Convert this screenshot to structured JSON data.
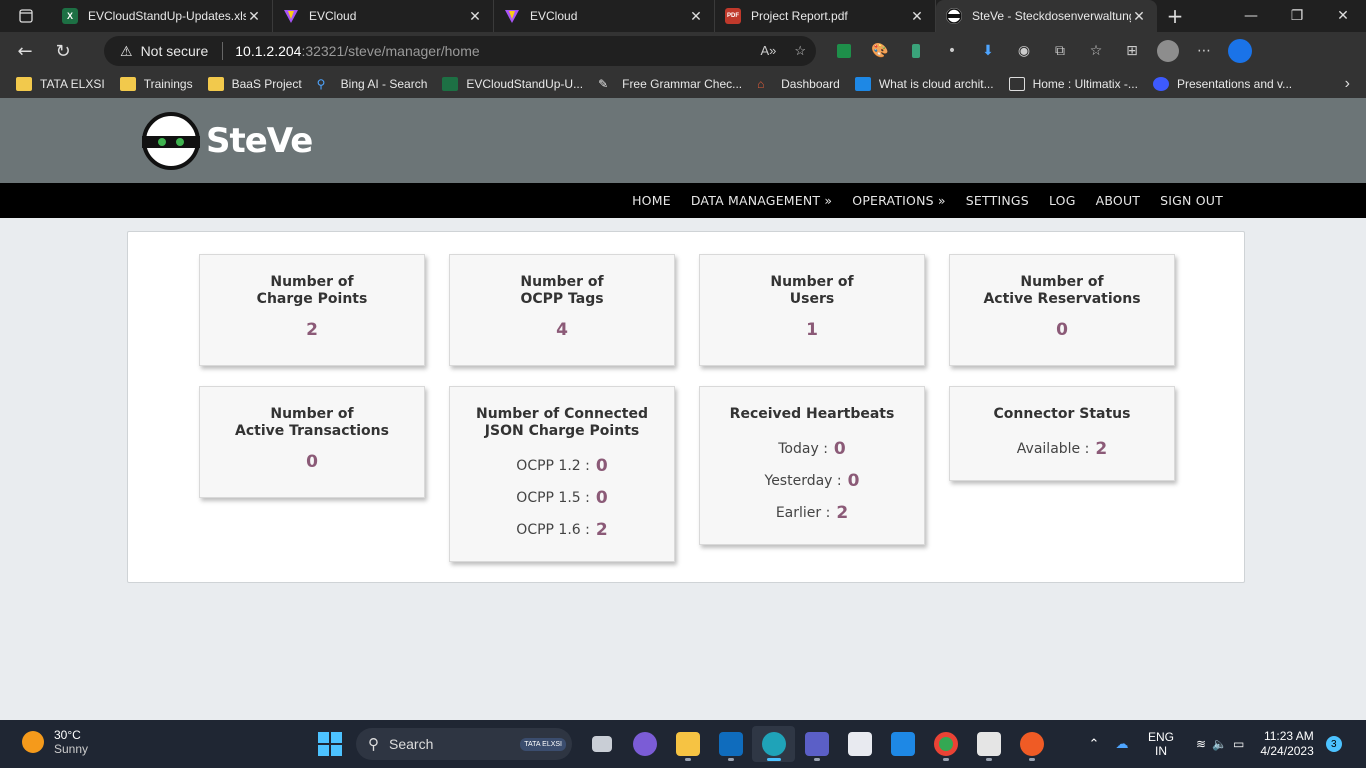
{
  "browser": {
    "tabs": [
      {
        "title": "EVCloudStandUp-Updates.xlsx",
        "icon": "excel-icon",
        "active": false
      },
      {
        "title": "EVCloud",
        "icon": "vite-icon",
        "active": false
      },
      {
        "title": "EVCloud",
        "icon": "vite-icon",
        "active": false
      },
      {
        "title": "Project Report.pdf",
        "icon": "pdf-icon",
        "active": false
      },
      {
        "title": "SteVe - Steckdosenverwaltung",
        "icon": "steve-icon",
        "active": true
      }
    ],
    "address": {
      "security_label": "Not secure",
      "host": "10.1.2.204",
      "path": ":32321/steve/manager/home"
    },
    "bookmarks": [
      {
        "label": "TATA ELXSI",
        "icon": "folder-icon"
      },
      {
        "label": "Trainings",
        "icon": "folder-icon"
      },
      {
        "label": "BaaS Project",
        "icon": "folder-icon"
      },
      {
        "label": "Bing AI - Search",
        "icon": "search-icon"
      },
      {
        "label": "EVCloudStandUp-U...",
        "icon": "excel-icon"
      },
      {
        "label": "Free Grammar Chec...",
        "icon": "pen-icon"
      },
      {
        "label": "Dashboard",
        "icon": "dashboard-icon"
      },
      {
        "label": "What is cloud archit...",
        "icon": "video-icon"
      },
      {
        "label": "Home : Ultimatix -...",
        "icon": "page-icon"
      },
      {
        "label": "Presentations and v...",
        "icon": "globe-icon"
      }
    ]
  },
  "app": {
    "logo_text": "SteVe",
    "nav": [
      "HOME",
      "DATA MANAGEMENT »",
      "OPERATIONS »",
      "SETTINGS",
      "LOG",
      "ABOUT",
      "SIGN OUT"
    ]
  },
  "cards": {
    "charge_points": {
      "title1": "Number of",
      "title2": "Charge Points",
      "value": "2"
    },
    "ocpp_tags": {
      "title1": "Number of",
      "title2": "OCPP Tags",
      "value": "4"
    },
    "users": {
      "title1": "Number of",
      "title2": "Users",
      "value": "1"
    },
    "reservations": {
      "title1": "Number of",
      "title2": "Active Reservations",
      "value": "0"
    },
    "transactions": {
      "title1": "Number of",
      "title2": "Active Transactions",
      "value": "0"
    },
    "json_cp": {
      "title1": "Number of Connected",
      "title2": "JSON Charge Points",
      "rows": [
        {
          "label": "OCPP 1.2 :",
          "value": "0"
        },
        {
          "label": "OCPP 1.5 :",
          "value": "0"
        },
        {
          "label": "OCPP 1.6 :",
          "value": "2"
        }
      ]
    },
    "heartbeats": {
      "title": "Received Heartbeats",
      "rows": [
        {
          "label": "Today :",
          "value": "0"
        },
        {
          "label": "Yesterday :",
          "value": "0"
        },
        {
          "label": "Earlier :",
          "value": "2"
        }
      ]
    },
    "connector": {
      "title": "Connector Status",
      "rows": [
        {
          "label": "Available :",
          "value": "2"
        }
      ]
    }
  },
  "taskbar": {
    "weather_temp": "30°C",
    "weather_cond": "Sunny",
    "search_label": "Search",
    "search_badge": "TATA ELXSI",
    "lang1": "ENG",
    "lang2": "IN",
    "time": "11:23 AM",
    "date": "4/24/2023",
    "notifications": "3"
  }
}
